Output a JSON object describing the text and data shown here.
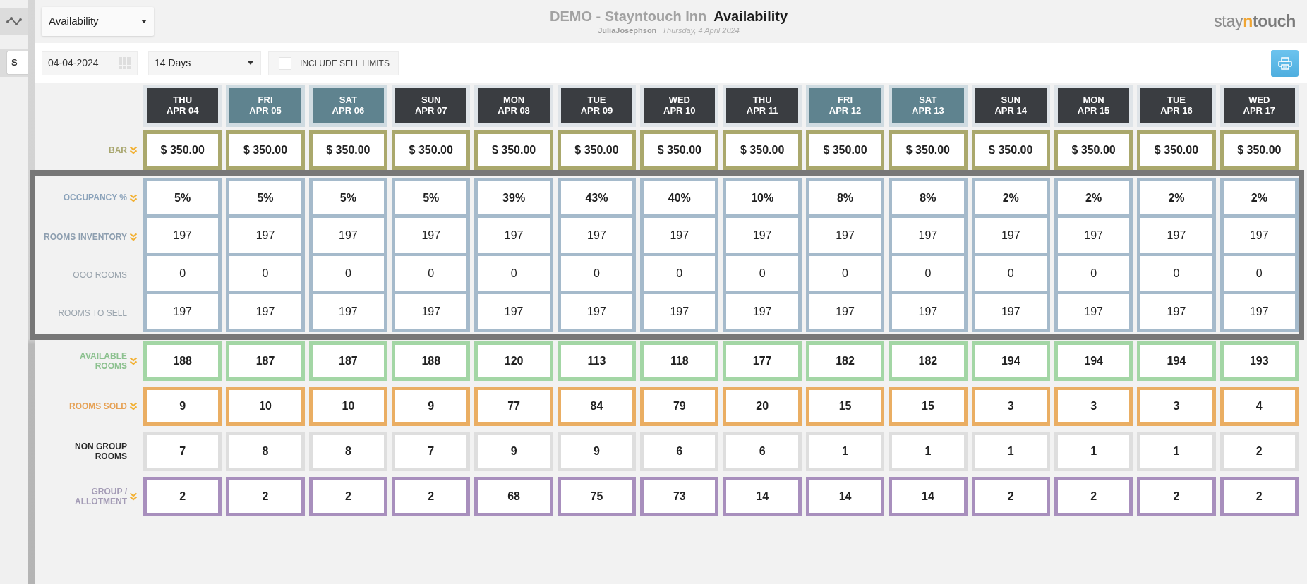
{
  "sidebar": {
    "button_label": "S"
  },
  "app_header": {
    "view_select": {
      "value": "Availability"
    },
    "hotel": "DEMO - Stayntouch Inn",
    "page_title": "Availability",
    "user": "JuliaJosephson",
    "date": "Thursday, 4 April 2024",
    "logo": [
      {
        "text": "stay",
        "kind": "light"
      },
      {
        "text": "n",
        "kind": "accent"
      },
      {
        "text": "touch",
        "kind": "bold"
      }
    ]
  },
  "toolbar": {
    "date_field": {
      "value": "04-04-2024"
    },
    "range_select": {
      "value": "14 Days"
    },
    "sell_limits": {
      "label": "INCLUDE SELL LIMITS",
      "checked": false
    }
  },
  "date_columns": [
    {
      "day": "THU",
      "date": "APR 04",
      "weekend": false
    },
    {
      "day": "FRI",
      "date": "APR 05",
      "weekend": true
    },
    {
      "day": "SAT",
      "date": "APR 06",
      "weekend": true
    },
    {
      "day": "SUN",
      "date": "APR 07",
      "weekend": false
    },
    {
      "day": "MON",
      "date": "APR 08",
      "weekend": false
    },
    {
      "day": "TUE",
      "date": "APR 09",
      "weekend": false
    },
    {
      "day": "WED",
      "date": "APR 10",
      "weekend": false
    },
    {
      "day": "THU",
      "date": "APR 11",
      "weekend": false
    },
    {
      "day": "FRI",
      "date": "APR 12",
      "weekend": true
    },
    {
      "day": "SAT",
      "date": "APR 13",
      "weekend": true
    },
    {
      "day": "SUN",
      "date": "APR 14",
      "weekend": false
    },
    {
      "day": "MON",
      "date": "APR 15",
      "weekend": false
    },
    {
      "day": "TUE",
      "date": "APR 16",
      "weekend": false
    },
    {
      "day": "WED",
      "date": "APR 17",
      "weekend": false
    }
  ],
  "sections": [
    {
      "highlighted": false,
      "rows": [
        {
          "label": {
            "text": "BAR",
            "color": "#a8a66e",
            "bold": true
          },
          "color": "#aaa86c",
          "expandable": true,
          "bold": true,
          "values": [
            "$ 350.00",
            "$ 350.00",
            "$ 350.00",
            "$ 350.00",
            "$ 350.00",
            "$ 350.00",
            "$ 350.00",
            "$ 350.00",
            "$ 350.00",
            "$ 350.00",
            "$ 350.00",
            "$ 350.00",
            "$ 350.00",
            "$ 350.00"
          ]
        }
      ]
    },
    {
      "highlighted": true,
      "rows": [
        {
          "label": {
            "text": "OCCUPANCY %",
            "color": "#8aa2ba",
            "bold": true
          },
          "color": "#a5bacb",
          "expandable": true,
          "bold": true,
          "values": [
            "5%",
            "5%",
            "5%",
            "5%",
            "39%",
            "43%",
            "40%",
            "10%",
            "8%",
            "8%",
            "2%",
            "2%",
            "2%",
            "2%"
          ]
        },
        {
          "label": {
            "text": "ROOMS INVENTORY",
            "color": "#8e9fb0",
            "bold": true
          },
          "color": "#a5bacb",
          "expandable": true,
          "bold": false,
          "values": [
            "197",
            "197",
            "197",
            "197",
            "197",
            "197",
            "197",
            "197",
            "197",
            "197",
            "197",
            "197",
            "197",
            "197"
          ]
        },
        {
          "label": {
            "text": "OOO ROOMS",
            "color": "#9ba5ae",
            "bold": false
          },
          "color": "#a5bacb",
          "expandable": false,
          "bold": false,
          "values": [
            "0",
            "0",
            "0",
            "0",
            "0",
            "0",
            "0",
            "0",
            "0",
            "0",
            "0",
            "0",
            "0",
            "0"
          ]
        },
        {
          "label": {
            "text": "ROOMS TO SELL",
            "color": "#9ba5ae",
            "bold": false
          },
          "color": "#a5bacb",
          "expandable": false,
          "bold": false,
          "values": [
            "197",
            "197",
            "197",
            "197",
            "197",
            "197",
            "197",
            "197",
            "197",
            "197",
            "197",
            "197",
            "197",
            "197"
          ]
        }
      ]
    },
    {
      "highlighted": false,
      "rows": [
        {
          "label": {
            "text": "AVAILABLE ROOMS",
            "color": "#8cc18f",
            "bold": true
          },
          "color": "#a3d6a5",
          "expandable": true,
          "bold": true,
          "values": [
            "188",
            "187",
            "187",
            "188",
            "120",
            "113",
            "118",
            "177",
            "182",
            "182",
            "194",
            "194",
            "194",
            "193"
          ]
        },
        {
          "label": {
            "text": "ROOMS SOLD",
            "color": "#e6a256",
            "bold": true
          },
          "color": "#eaae63",
          "expandable": true,
          "bold": true,
          "values": [
            "9",
            "10",
            "10",
            "9",
            "77",
            "84",
            "79",
            "20",
            "15",
            "15",
            "3",
            "3",
            "3",
            "4"
          ]
        },
        {
          "label": {
            "text": "NON GROUP ROOMS",
            "color": "#2a2a2a",
            "bold": true
          },
          "color": "#dedede",
          "expandable": false,
          "bold": true,
          "values": [
            "7",
            "8",
            "8",
            "7",
            "9",
            "9",
            "6",
            "6",
            "1",
            "1",
            "1",
            "1",
            "1",
            "2"
          ]
        },
        {
          "label": {
            "text": "GROUP / ALLOTMENT",
            "color": "#a49cb6",
            "bold": true
          },
          "color": "#a88fbd",
          "expandable": true,
          "bold": true,
          "values": [
            "2",
            "2",
            "2",
            "2",
            "68",
            "75",
            "73",
            "14",
            "14",
            "14",
            "2",
            "2",
            "2",
            "2"
          ]
        }
      ]
    }
  ]
}
